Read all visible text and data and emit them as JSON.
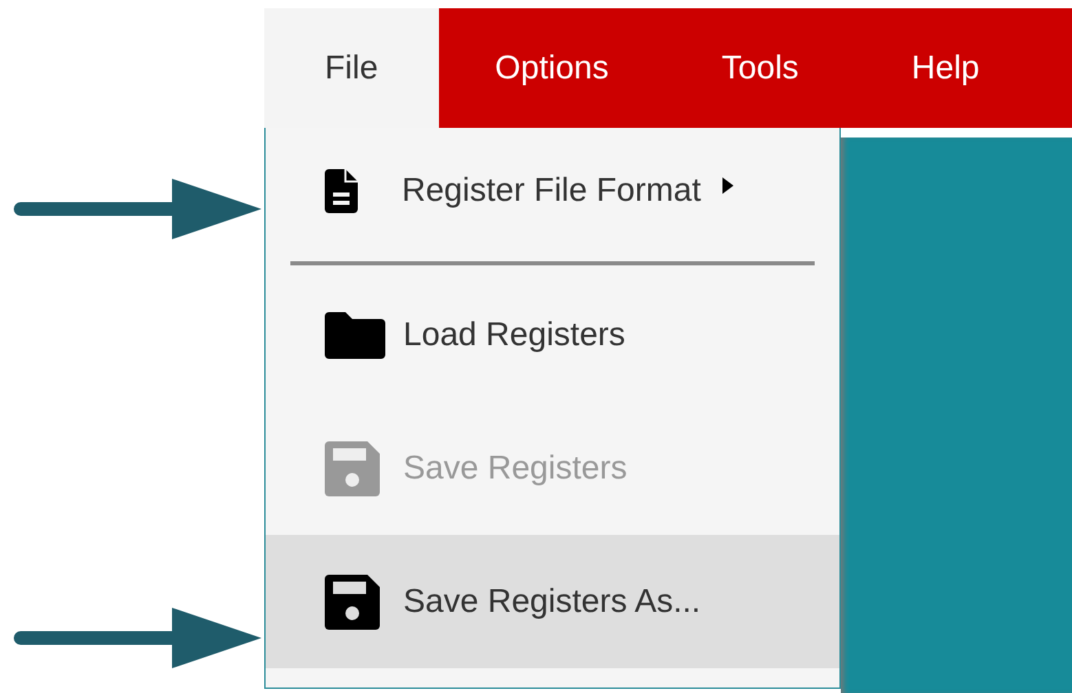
{
  "menubar": {
    "tabs": [
      {
        "label": "File",
        "selected": true
      },
      {
        "label": "Options",
        "selected": false
      },
      {
        "label": "Tools",
        "selected": false
      },
      {
        "label": "Help",
        "selected": false
      }
    ]
  },
  "file_menu": {
    "items": [
      {
        "kind": "submenu",
        "label": "Register File Format",
        "disabled": false,
        "selected": false
      },
      {
        "kind": "separator"
      },
      {
        "kind": "item",
        "label": "Load Registers",
        "disabled": false,
        "selected": false
      },
      {
        "kind": "item",
        "label": "Save Registers",
        "disabled": true,
        "selected": false
      },
      {
        "kind": "item",
        "label": "Save Registers As...",
        "disabled": false,
        "selected": true
      }
    ]
  }
}
